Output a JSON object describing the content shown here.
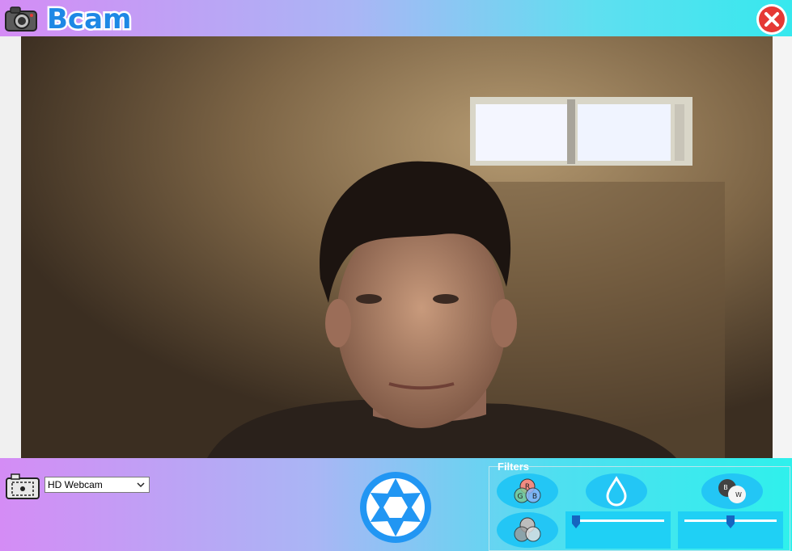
{
  "app": {
    "logo_text": "Bcam",
    "logo_color": "#1e88e5"
  },
  "titlebar": {
    "close_icon": "close-icon",
    "close_color": "#e53935"
  },
  "video": {
    "description_icon": "webcam-feed"
  },
  "camera": {
    "selected_device": "HD Webcam"
  },
  "capture": {
    "icon": "shutter-icon",
    "color": "#2196f3"
  },
  "filters": {
    "legend": "Filters",
    "rgb_labels": {
      "r": "R",
      "g": "G",
      "b": "B"
    },
    "bw_labels": {
      "b": "B",
      "w": "W"
    },
    "brightness_level": 0.0,
    "bw_level": 0.5
  }
}
